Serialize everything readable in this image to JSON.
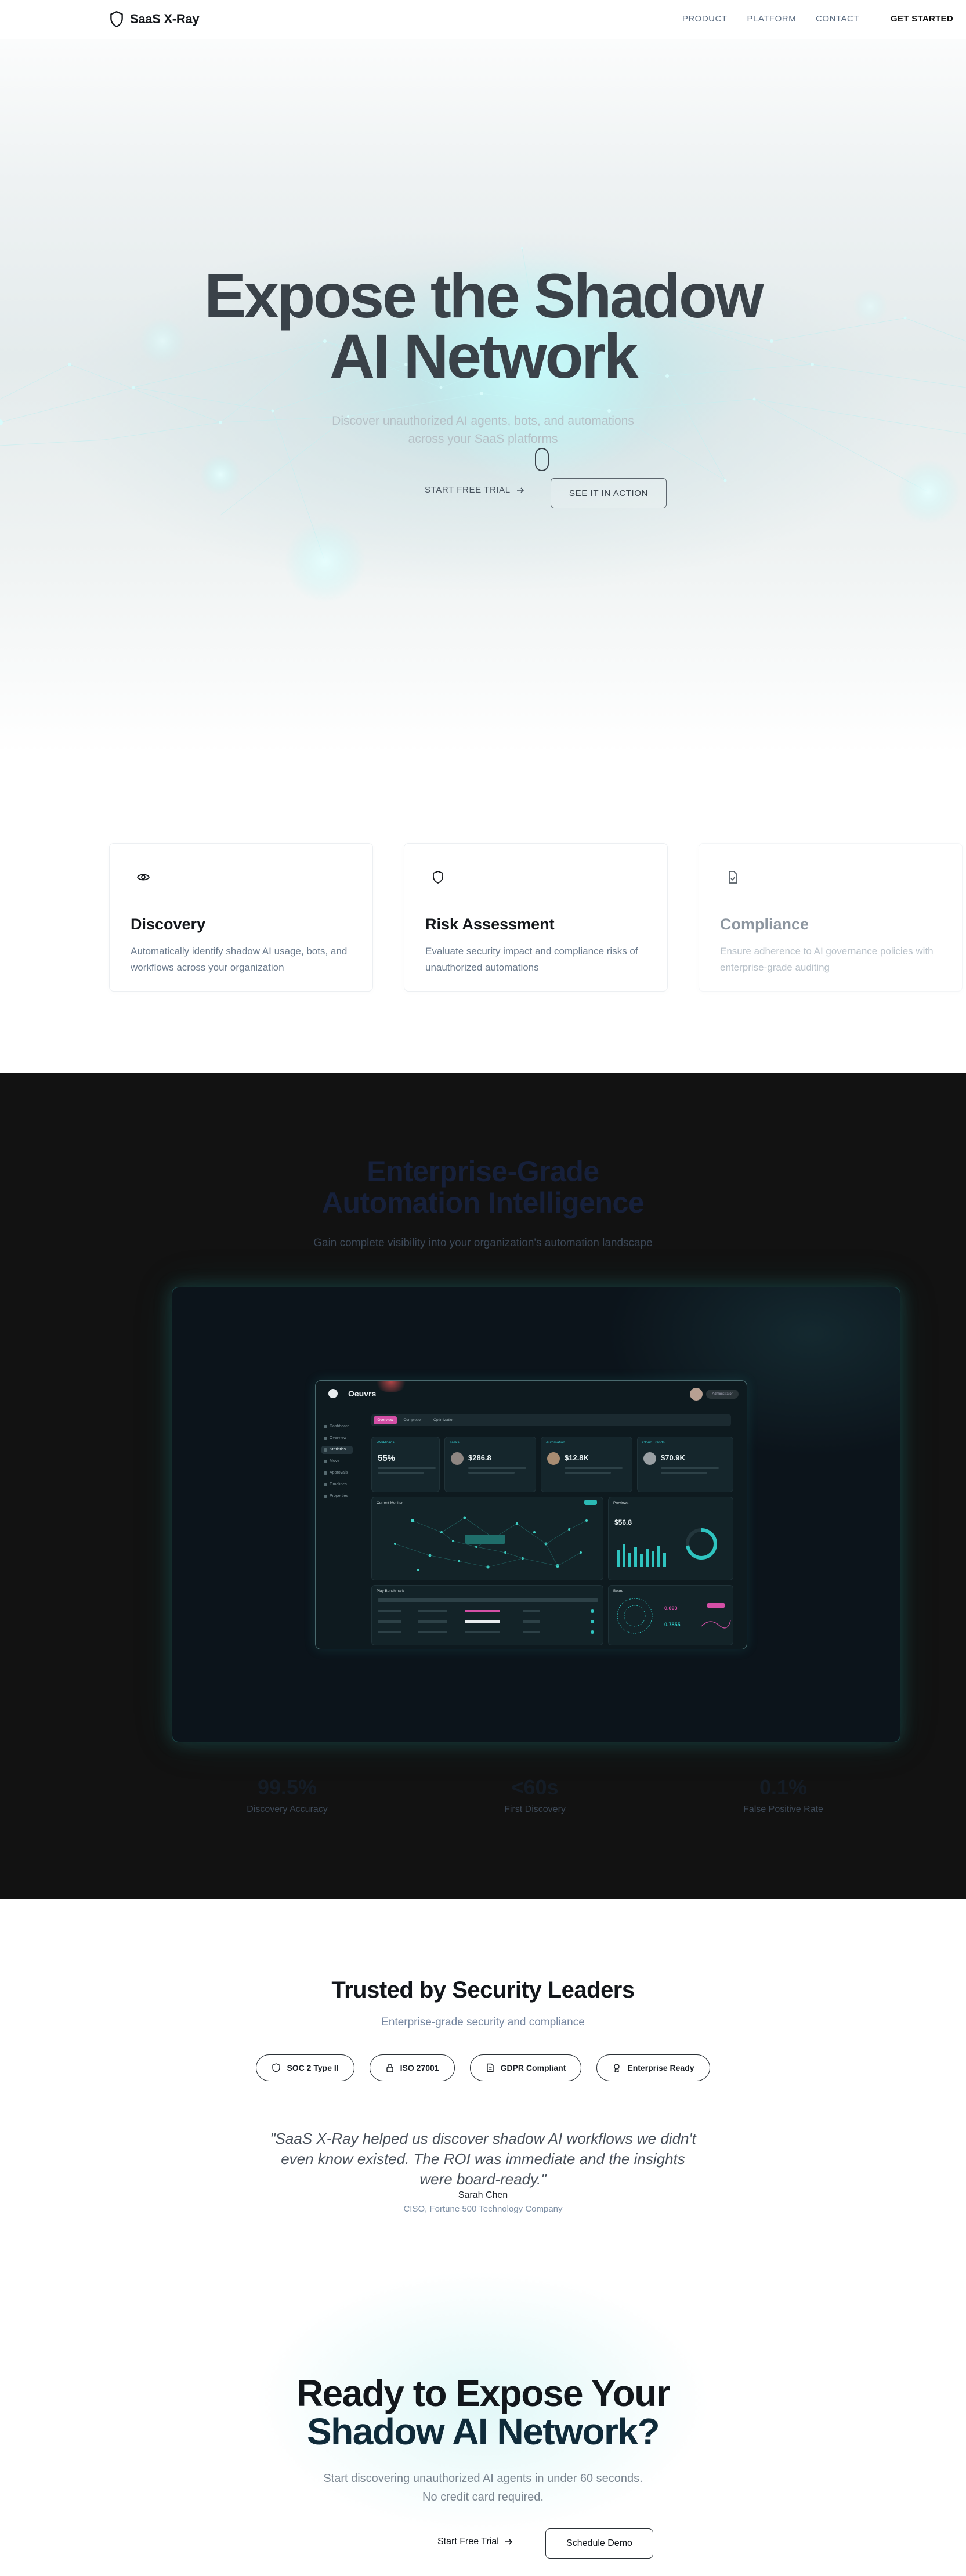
{
  "nav": {
    "brand": "SaaS X-Ray",
    "links": [
      "PRODUCT",
      "PLATFORM",
      "CONTACT"
    ],
    "cta": "GET STARTED"
  },
  "hero": {
    "title_line1": "Expose the Shadow",
    "title_line2": "AI Network",
    "subtitle": "Discover unauthorized AI agents, bots, and automations across your SaaS platforms",
    "primary_cta": "START FREE TRIAL",
    "secondary_cta": "SEE IT IN ACTION"
  },
  "features": [
    {
      "title": "Discovery",
      "description": "Automatically identify shadow AI usage, bots, and workflows across your organization",
      "icon": "eye-icon"
    },
    {
      "title": "Risk Assessment",
      "description": "Evaluate security impact and compliance risks of unauthorized automations",
      "icon": "shield-icon"
    },
    {
      "title": "Compliance",
      "description": "Ensure adherence to AI governance policies with enterprise-grade auditing",
      "icon": "document-check-icon"
    }
  ],
  "intelligence": {
    "title_line1": "Enterprise-Grade",
    "title_line2": "Automation Intelligence",
    "subtitle": "Gain complete visibility into your organization's automation landscape",
    "stats": [
      {
        "value": "99.5%",
        "label": "Discovery Accuracy"
      },
      {
        "value": "<60s",
        "label": "First Discovery"
      },
      {
        "value": "0.1%",
        "label": "False Positive Rate"
      }
    ],
    "dashboard": {
      "title": "Oeuvrs",
      "user": "Administrator",
      "nav": [
        "Dashboard",
        "Overview",
        "Statistics",
        "Move",
        "Approvals",
        "Timelines",
        "Properties"
      ],
      "tabs": [
        "Overview",
        "Completion",
        "Optimization"
      ],
      "kpis": [
        {
          "label": "Workloads",
          "value": "55%"
        },
        {
          "label": "Tasks",
          "value": "$286.8"
        },
        {
          "label": "Automation",
          "value": "$12.8K"
        },
        {
          "label": "Cloud Trends",
          "value": "$70.9K"
        }
      ],
      "panels": [
        "Current Monitor",
        "Previews",
        "Play Benchmark",
        "Board"
      ],
      "preview_value": "$56.8",
      "board_values": [
        "0.893",
        "0.7855"
      ]
    }
  },
  "trust": {
    "title": "Trusted by Security Leaders",
    "subtitle": "Enterprise-grade security and compliance",
    "badges": [
      {
        "label": "SOC 2 Type II",
        "icon": "shield-icon"
      },
      {
        "label": "ISO 27001",
        "icon": "lock-icon"
      },
      {
        "label": "GDPR Compliant",
        "icon": "document-icon"
      },
      {
        "label": "Enterprise Ready",
        "icon": "badge-icon"
      }
    ],
    "quote": "\"SaaS X-Ray helped us discover shadow AI workflows we didn't even know existed. The ROI was immediate and the insights were board-ready.\"",
    "author": "Sarah Chen",
    "role": "CISO, Fortune 500 Technology Company"
  },
  "cta": {
    "title_line1": "Ready to Expose Your",
    "title_line2": "Shadow AI Network?",
    "subtitle_line1": "Start discovering unauthorized AI agents in under 60 seconds.",
    "subtitle_line2": "No credit card required.",
    "primary": "Start Free Trial",
    "secondary": "Schedule Demo"
  }
}
